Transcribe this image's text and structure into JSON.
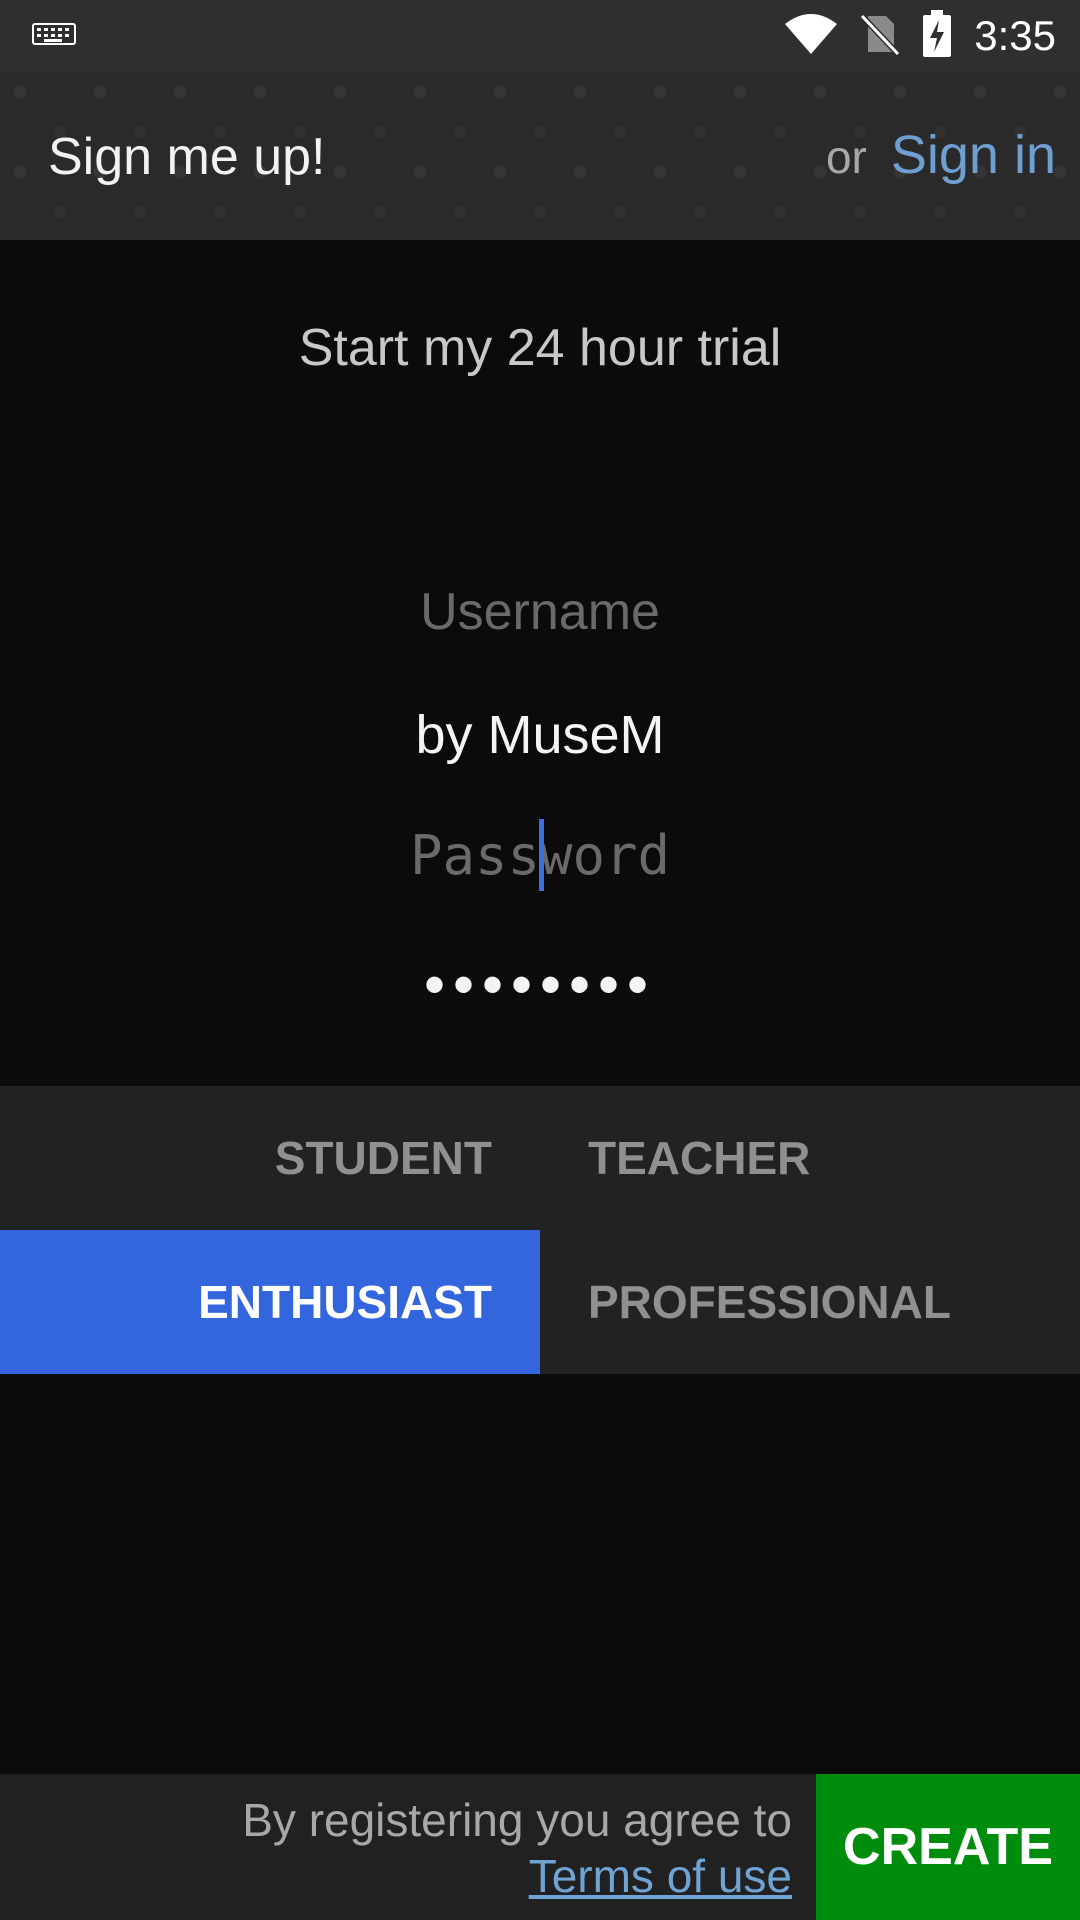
{
  "status_bar": {
    "left_icon": "keyboard-icon",
    "icons": [
      "wifi-icon",
      "no-sim-icon",
      "battery-charging-icon"
    ],
    "time": "3:35"
  },
  "header": {
    "title": "Sign me up!",
    "or_text": "or",
    "signin_label": "Sign in"
  },
  "main": {
    "trial_text": "Start my 24 hour trial",
    "username_label": "Username",
    "username_value": "by MuseM",
    "password_label": "Password",
    "password_value": "••••••••"
  },
  "roles": {
    "student": "STUDENT",
    "teacher": "TEACHER",
    "enthusiast": "ENTHUSIAST",
    "professional": "PROFESSIONAL",
    "selected": "ENTHUSIAST"
  },
  "footer": {
    "terms_prefix": "By registering you agree to",
    "terms_link": "Terms of use",
    "create_label": "CREATE"
  },
  "colors": {
    "accent": "#3366dd",
    "create": "#008c0c",
    "link": "#6fa3d4"
  }
}
